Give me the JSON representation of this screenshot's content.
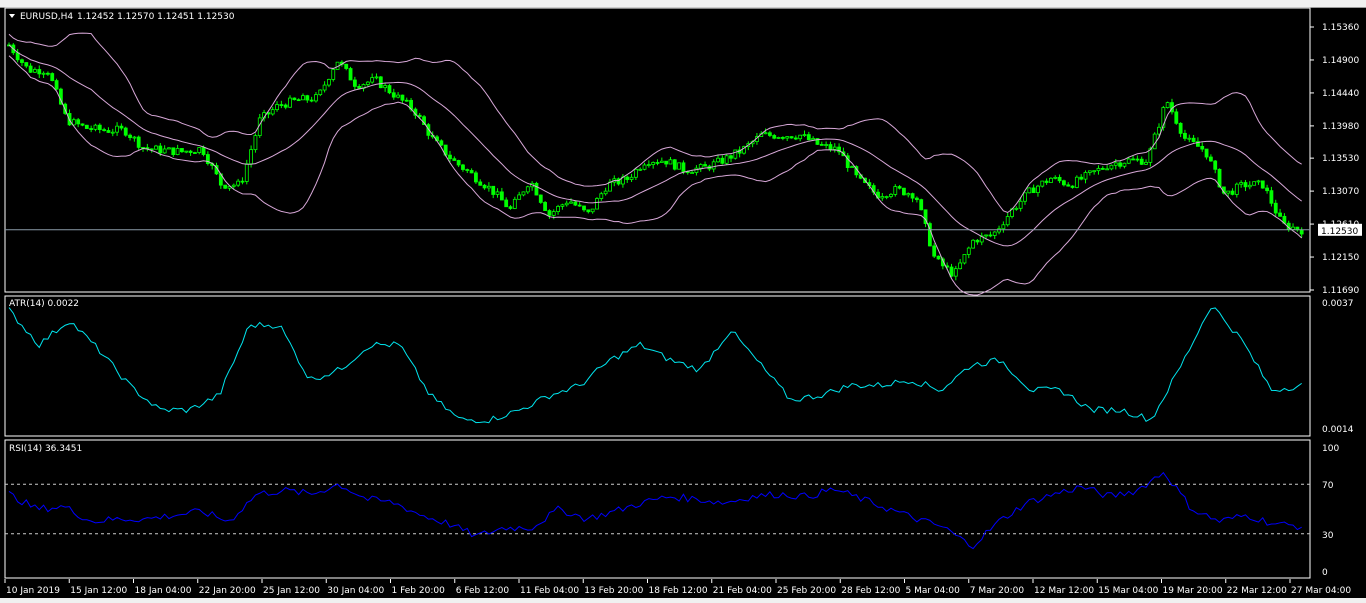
{
  "header": {
    "symbol_timeframe": "EURUSD,H4",
    "ohlc": "1.12452 1.12570 1.12451 1.12530"
  },
  "colors": {
    "bull": "#00ff00",
    "bands": "#d8a8d8",
    "atr": "#00e5ee",
    "rsi": "#0000ff",
    "bg": "#000000"
  },
  "chart_data": [
    {
      "type": "candlestick",
      "title": "EURUSD,H4",
      "current_price": "1.12530",
      "y_ticks": [
        "1.15360",
        "1.14900",
        "1.14440",
        "1.13980",
        "1.13530",
        "1.13070",
        "1.12610",
        "1.12150",
        "1.11690"
      ],
      "ylim": [
        1.1169,
        1.1536
      ],
      "closes": [
        1.1511,
        1.1476,
        1.1476,
        1.1406,
        1.1395,
        1.1392,
        1.1392,
        1.1367,
        1.1364,
        1.1362,
        1.1367,
        1.1316,
        1.1316,
        1.1406,
        1.1427,
        1.1434,
        1.1437,
        1.149,
        1.1455,
        1.1462,
        1.1441,
        1.142,
        1.1378,
        1.135,
        1.133,
        1.1309,
        1.1281,
        1.1323,
        1.1274,
        1.1295,
        1.1274,
        1.1316,
        1.1323,
        1.135,
        1.135,
        1.1337,
        1.1339,
        1.135,
        1.1364,
        1.1385,
        1.1385,
        1.1385,
        1.1371,
        1.1364,
        1.1323,
        1.1302,
        1.1309,
        1.1302,
        1.1211,
        1.119,
        1.1239,
        1.1246,
        1.1281,
        1.1309,
        1.1325,
        1.1316,
        1.133,
        1.1344,
        1.135,
        1.135,
        1.1434,
        1.1378,
        1.1364,
        1.1302,
        1.1316,
        1.1316,
        1.126,
        1.1253
      ],
      "indicator": "Bollinger Bands (20, 2)"
    },
    {
      "type": "line",
      "title": "ATR(14) 0.0022",
      "y_ticks": [
        "0.0037",
        "0.0014"
      ],
      "ylim": [
        0.0014,
        0.0037
      ],
      "values": [
        0.00355,
        0.00292,
        0.00337,
        0.00282,
        0.00218,
        0.00173,
        0.00173,
        0.002,
        0.00328,
        0.00328,
        0.00228,
        0.00246,
        0.00292,
        0.00292,
        0.002,
        0.00155,
        0.00155,
        0.00173,
        0.002,
        0.00218,
        0.00264,
        0.00292,
        0.00264,
        0.00246,
        0.00319,
        0.00255,
        0.00191,
        0.002,
        0.00218,
        0.00218,
        0.00228,
        0.00209,
        0.00255,
        0.00264,
        0.00209,
        0.00209,
        0.00173,
        0.00173,
        0.00155,
        0.00255,
        0.00365,
        0.00301,
        0.00209,
        0.00218
      ]
    },
    {
      "type": "line",
      "title": "RSI(14) 36.3451",
      "y_ticks": [
        "100",
        "70",
        "30",
        "0"
      ],
      "ylim": [
        0,
        100
      ],
      "levels": [
        70,
        30
      ],
      "values": [
        62,
        50,
        52,
        40,
        42,
        42,
        45,
        48,
        40,
        62,
        65,
        62,
        70,
        58,
        55,
        45,
        38,
        28,
        35,
        35,
        50,
        42,
        48,
        55,
        60,
        58,
        55,
        60,
        62,
        60,
        66,
        58,
        50,
        42,
        35,
        20,
        40,
        55,
        62,
        68,
        60,
        65,
        80,
        50,
        40,
        45,
        38,
        36
      ]
    }
  ],
  "x_ticks": [
    "10 Jan 2019",
    "15 Jan 12:00",
    "18 Jan 04:00",
    "22 Jan 20:00",
    "25 Jan 12:00",
    "30 Jan 04:00",
    "1 Feb 20:00",
    "6 Feb 12:00",
    "11 Feb 04:00",
    "13 Feb 20:00",
    "18 Feb 12:00",
    "21 Feb 04:00",
    "25 Feb 20:00",
    "28 Feb 12:00",
    "5 Mar 04:00",
    "7 Mar 20:00",
    "12 Mar 12:00",
    "15 Mar 04:00",
    "19 Mar 20:00",
    "22 Mar 12:00",
    "27 Mar 04:00"
  ]
}
